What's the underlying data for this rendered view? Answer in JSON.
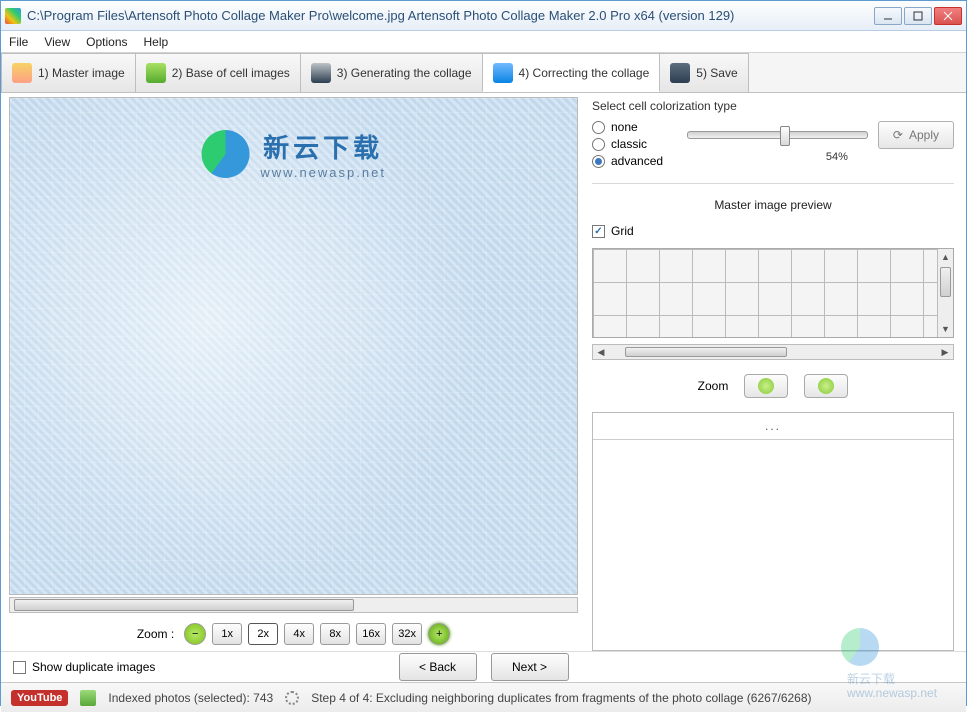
{
  "window": {
    "title": "C:\\Program Files\\Artensoft Photo Collage Maker Pro\\welcome.jpg Artensoft Photo Collage Maker  2.0 Pro x64 (version 129)"
  },
  "menu": {
    "file": "File",
    "view": "View",
    "options": "Options",
    "help": "Help"
  },
  "tabs": {
    "t1": "1) Master image",
    "t2": "2) Base of cell images",
    "t3": "3) Generating the collage",
    "t4": "4) Correcting the collage",
    "t5": "5) Save"
  },
  "watermark": {
    "cn": "新云下载",
    "url": "www.newasp.net"
  },
  "zoom": {
    "label": "Zoom  :",
    "b1": "1x",
    "b2": "2x",
    "b4": "4x",
    "b8": "8x",
    "b16": "16x",
    "b32": "32x"
  },
  "right": {
    "select_label": "Select cell colorization type",
    "opt_none": "none",
    "opt_classic": "classic",
    "opt_advanced": "advanced",
    "slider_val": "54%",
    "apply": "Apply",
    "preview_title": "Master image preview",
    "grid": "Grid",
    "zoom_label": "Zoom",
    "detail_header": "..."
  },
  "footer": {
    "show_dup": "Show duplicate images",
    "back": "< Back",
    "next": "Next >"
  },
  "status": {
    "youtube": "YouTube",
    "indexed": "Indexed photos (selected): 743",
    "step": "Step 4 of 4: Excluding neighboring duplicates from fragments of the photo collage (6267/6268)"
  }
}
